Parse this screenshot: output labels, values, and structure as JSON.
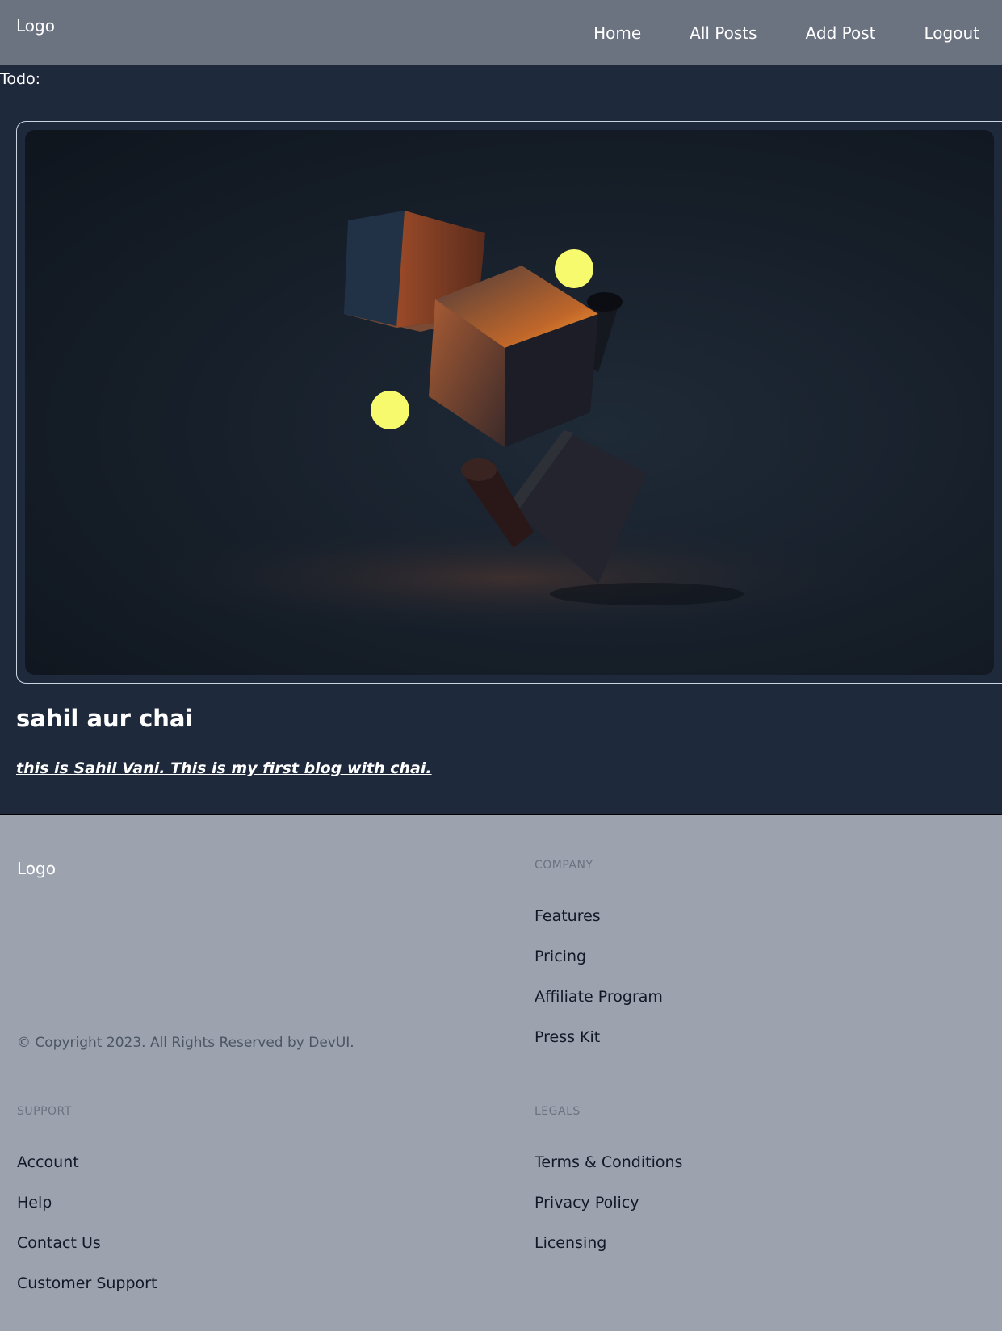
{
  "header": {
    "logo": "Logo",
    "nav": [
      {
        "label": "Home"
      },
      {
        "label": "All Posts"
      },
      {
        "label": "Add Post"
      },
      {
        "label": "Logout"
      }
    ]
  },
  "main": {
    "todo_label": "Todo:",
    "post": {
      "title": "sahil aur chai",
      "content": "this is Sahil Vani. This is my first blog with chai."
    }
  },
  "footer": {
    "logo": "Logo",
    "copyright": "© Copyright 2023. All Rights Reserved by DevUI.",
    "columns": {
      "company": {
        "title": "Company",
        "links": [
          "Features",
          "Pricing",
          "Affiliate Program",
          "Press Kit"
        ]
      },
      "support": {
        "title": "Support",
        "links": [
          "Account",
          "Help",
          "Contact Us",
          "Customer Support"
        ]
      },
      "legals": {
        "title": "Legals",
        "links": [
          "Terms & Conditions",
          "Privacy Policy",
          "Licensing"
        ]
      }
    }
  },
  "colors": {
    "header_bg": "#6b7280",
    "page_bg": "#1e293b",
    "footer_bg": "#9ca3af",
    "orb_yellow": "#f8fa6e"
  }
}
